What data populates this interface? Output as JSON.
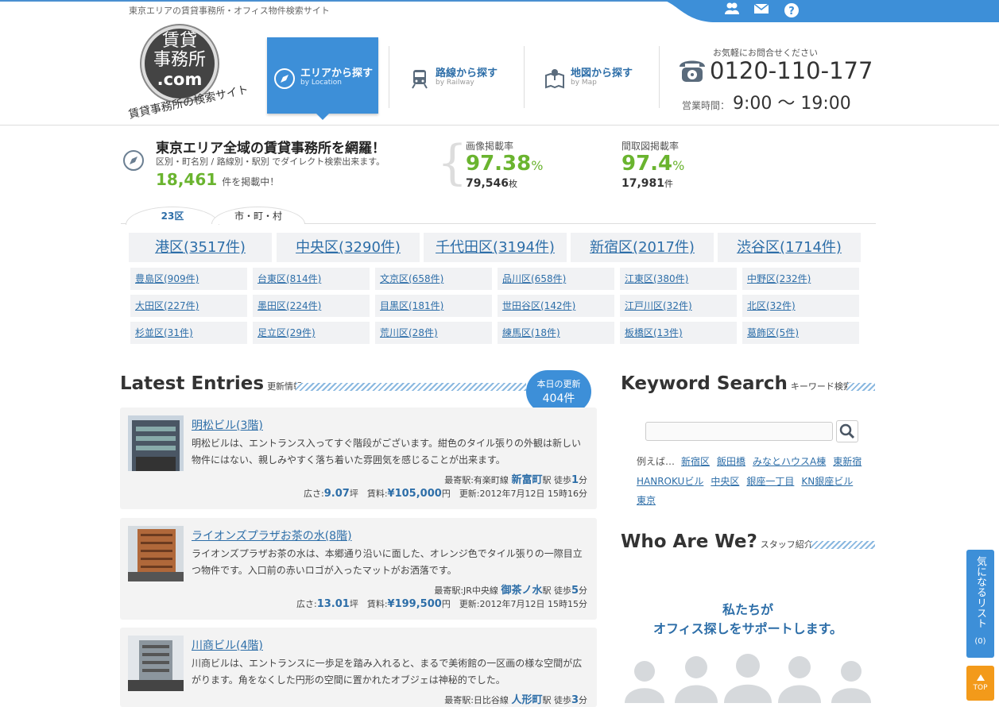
{
  "header": {
    "tagline": "東京エリアの賃貸事務所・オフィス物件検索サイト",
    "logo": {
      "line1": "賃貸",
      "line2": "事務所",
      "line3": ".com",
      "sub": "賃貸事務所の検索サイト"
    },
    "top_icons": [
      "staff-icon",
      "mail-icon",
      "help-icon"
    ],
    "nav": [
      {
        "label": "エリアから探す",
        "sub": "by Location",
        "icon": "compass-icon",
        "active": true
      },
      {
        "label": "路線から探す",
        "sub": "by Railway",
        "icon": "train-icon",
        "active": false
      },
      {
        "label": "地図から探す",
        "sub": "by Map",
        "icon": "map-icon",
        "active": false
      }
    ],
    "contact": {
      "prompt": "お気軽にお問合せください",
      "phone": "0120-110-177",
      "hours_label": "営業時間：",
      "hours": "9:00 ～ 19:00"
    }
  },
  "summary": {
    "headline": "東京エリア全域の賃貸事務所を網羅！",
    "desc": "区別・町名別 / 路線別・駅別 でダイレクト検索出来ます。",
    "count": "18,461",
    "count_suffix": "件を掲載中！",
    "stats": [
      {
        "label": "画像掲載率",
        "pct": "97.38",
        "unit": "%",
        "count": "79,546",
        "count_unit": "枚"
      },
      {
        "label": "間取図掲載率",
        "pct": "97.4",
        "unit": "%",
        "count": "17,981",
        "count_unit": "件"
      }
    ]
  },
  "ward_tabs": [
    "23区",
    "市・町・村"
  ],
  "big_wards": [
    "港区(3517件)",
    "中央区(3290件)",
    "千代田区(3194件)",
    "新宿区(2017件)",
    "渋谷区(1714件)"
  ],
  "small_wards": [
    [
      "豊島区(909件)",
      "台東区(814件)",
      "文京区(658件)",
      "品川区(658件)",
      "江東区(380件)",
      "中野区(232件)"
    ],
    [
      "大田区(227件)",
      "墨田区(224件)",
      "目黒区(181件)",
      "世田谷区(142件)",
      "江戸川区(32件)",
      "北区(32件)"
    ],
    [
      "杉並区(31件)",
      "足立区(29件)",
      "荒川区(28件)",
      "練馬区(18件)",
      "板橋区(13件)",
      "葛飾区(5件)"
    ]
  ],
  "latest": {
    "title": "Latest Entries",
    "sub": "更新情報",
    "badge_label": "本日の更新",
    "badge_count": "404件",
    "entries": [
      {
        "title": "明松ビル(3階)",
        "desc": "明松ビルは、エントランス入ってすぐ階段がございます。紺色のタイル張りの外観は新しい物件にはない、親しみやすく落ち着いた雰囲気を感じることが出来ます。",
        "station_prefix": "最寄駅:有楽町線",
        "station": "新富町",
        "walk_prefix": "駅 徒歩",
        "walk": "1",
        "walk_unit": "分",
        "area_label": "広さ:",
        "area": "9.07",
        "area_unit": "坪",
        "rent_label": "賃料:",
        "rent": "¥105,000",
        "rent_unit": "円",
        "updated": "更新:2012年7月12日 15時16分"
      },
      {
        "title": "ライオンズプラザお茶の水(8階)",
        "desc": "ライオンズプラザお茶の水は、本郷通り沿いに面した、オレンジ色でタイル張りの一際目立つ物件です。入口前の赤いロゴが入ったマットがお洒落です。",
        "station_prefix": "最寄駅:JR中央線",
        "station": "御茶ノ水",
        "walk_prefix": "駅 徒歩",
        "walk": "5",
        "walk_unit": "分",
        "area_label": "広さ:",
        "area": "13.01",
        "area_unit": "坪",
        "rent_label": "賃料:",
        "rent": "¥199,500",
        "rent_unit": "円",
        "updated": "更新:2012年7月12日 15時15分"
      },
      {
        "title": "川商ビル(4階)",
        "desc": "川商ビルは、エントランスに一歩足を踏み入れると、まるで美術館の一区画の様な空間が広がります。角をなくした円形の空間に置かれたオブジェは神秘的でした。",
        "station_prefix": "最寄駅:日比谷線",
        "station": "人形町",
        "walk_prefix": "駅 徒歩",
        "walk": "3",
        "walk_unit": "分"
      }
    ]
  },
  "keyword": {
    "title": "Keyword Search",
    "sub": "キーワード検索",
    "input_value": "",
    "example_label": "例えば…",
    "examples_row1": [
      "新宿区",
      "飯田橋",
      "みなとハウスA棟",
      "東新宿"
    ],
    "examples_row2": [
      "HANROKUビル",
      "中央区",
      "銀座一丁目",
      "KN銀座ビル"
    ],
    "examples_row3": [
      "東京"
    ]
  },
  "staff": {
    "title": "Who Are We?",
    "sub": "スタッフ紹介",
    "line1": "私たちが",
    "line2": "オフィス探しをサポートします。"
  },
  "side": {
    "fav_label": "気になるリスト",
    "fav_count": "(0)",
    "top_label": "TOP"
  },
  "colors": {
    "accent": "#3d8fd8",
    "green": "#6ab42f",
    "link": "#2d6ea8",
    "orange": "#f39a1a"
  }
}
